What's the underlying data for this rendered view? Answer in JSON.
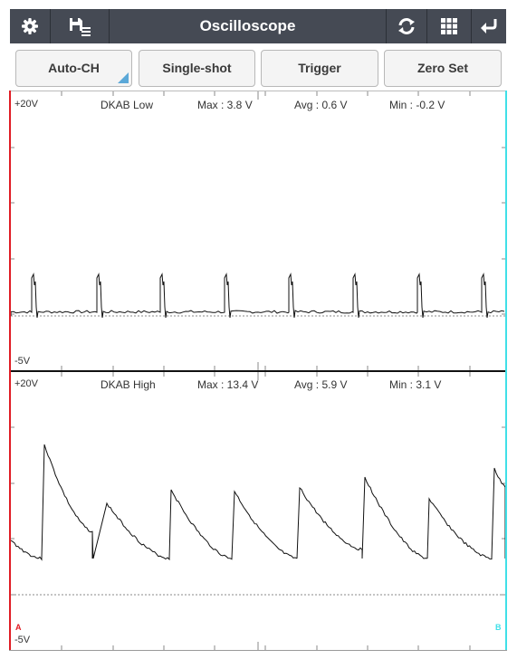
{
  "toolbar": {
    "title": "Oscilloscope",
    "icons": [
      "gear-icon",
      "save-list-icon",
      "refresh-icon",
      "grid-icon",
      "back-icon"
    ]
  },
  "buttons": {
    "auto_ch": "Auto-CH",
    "single_shot": "Single-shot",
    "trigger": "Trigger",
    "zero_set": "Zero Set"
  },
  "channels": [
    {
      "name": "DKAB Low",
      "max": "Max : 3.8 V",
      "avg": "Avg : 0.6 V",
      "min": "Min : -0.2 V",
      "top": "+20V",
      "bottom": "-5V"
    },
    {
      "name": "DKAB High",
      "max": "Max : 13.4 V",
      "avg": "Avg : 5.9 V",
      "min": "Min : 3.1 V",
      "top": "+20V",
      "bottom": "-5V"
    }
  ],
  "markers": {
    "a": "A",
    "b": "B"
  },
  "colors": {
    "toolbar_bg": "#454a54",
    "cursor_a": "#e01c24",
    "cursor_b": "#3fe0e8",
    "trace": "#111111",
    "corner_accent": "#5ba8d8"
  }
}
